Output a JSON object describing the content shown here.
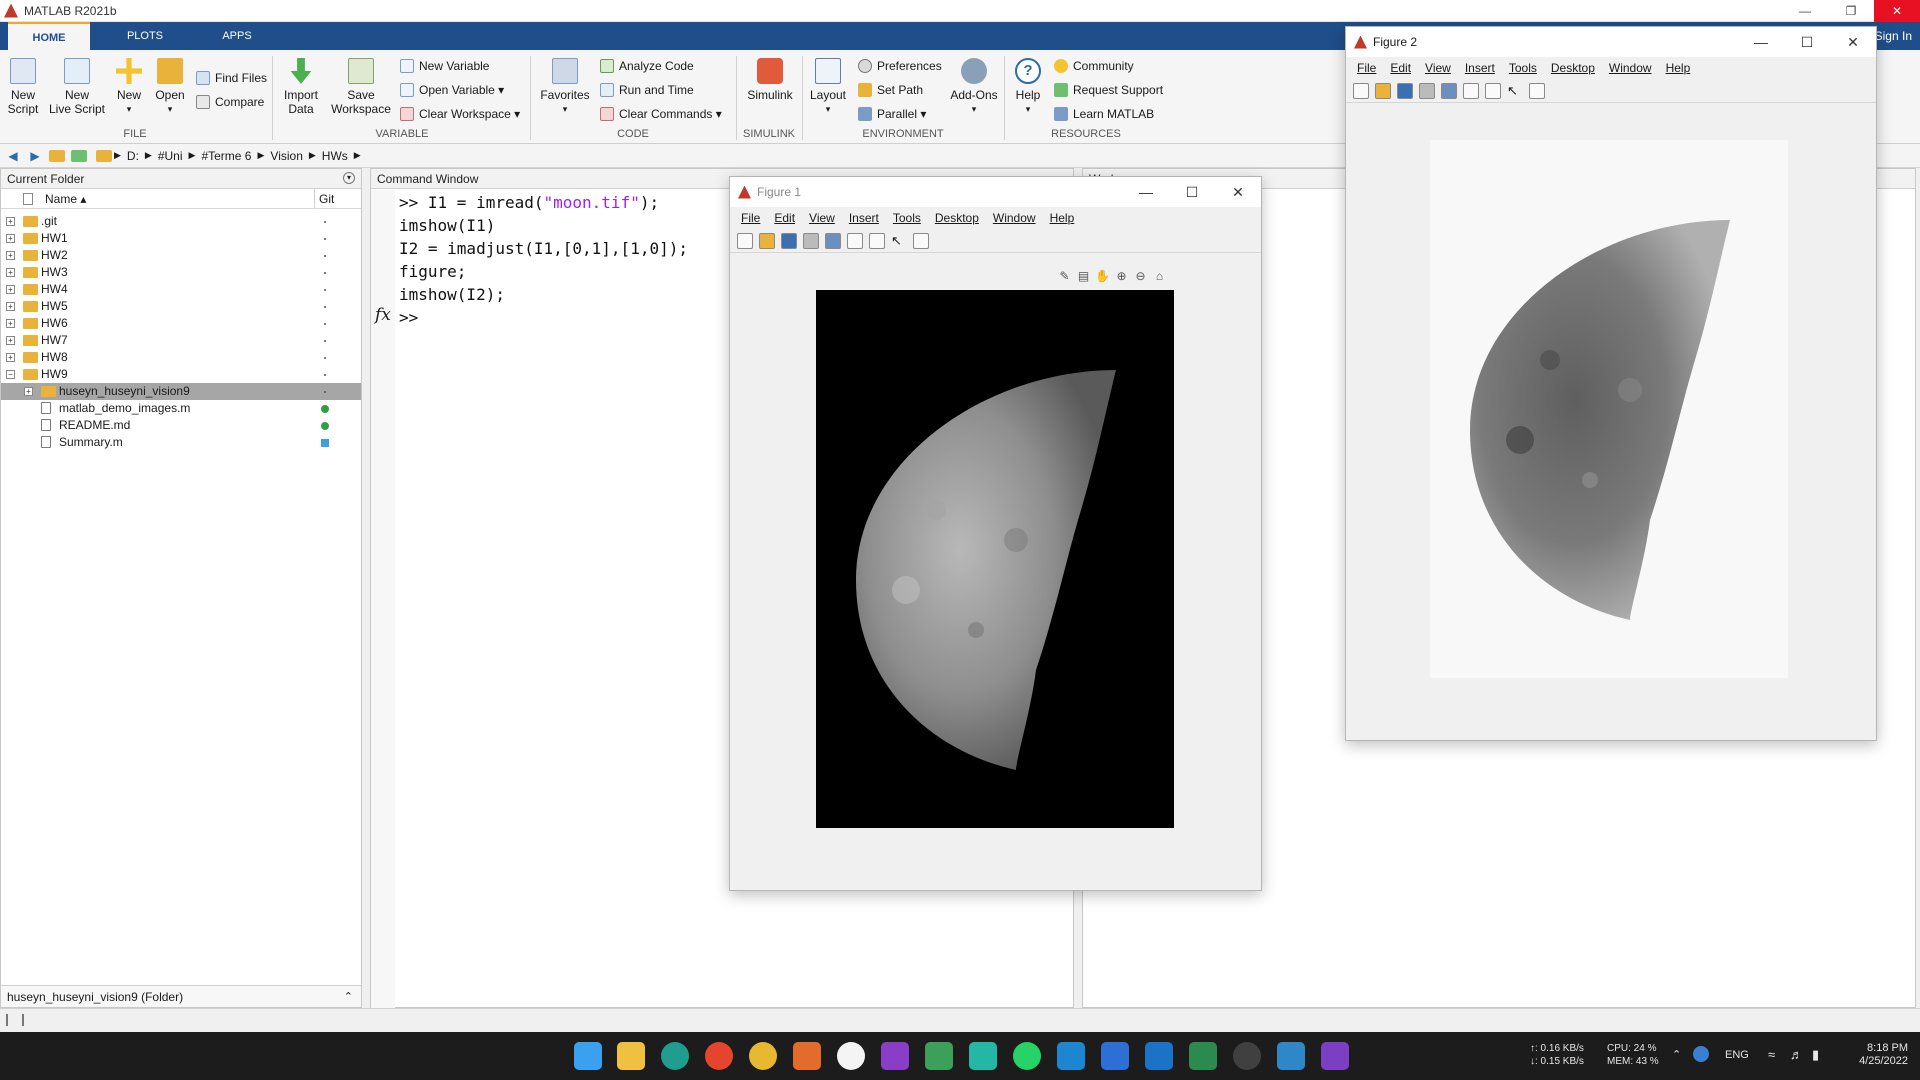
{
  "app": {
    "title": "MATLAB R2021b",
    "sign_in": "Sign In"
  },
  "tabs": [
    {
      "label": "HOME"
    },
    {
      "label": "PLOTS"
    },
    {
      "label": "APPS"
    }
  ],
  "ribbon": {
    "new_script": "New\nScript",
    "new_live_script": "New\nLive Script",
    "new": "New",
    "open": "Open",
    "find_files": "Find Files",
    "compare": "Compare",
    "import_data": "Import\nData",
    "save_workspace": "Save\nWorkspace",
    "new_variable": "New Variable",
    "open_variable": "Open Variable ▾",
    "clear_workspace": "Clear Workspace ▾",
    "favorites": "Favorites",
    "analyze_code": "Analyze Code",
    "run_and_time": "Run and Time",
    "clear_commands": "Clear Commands ▾",
    "simulink": "Simulink",
    "layout": "Layout",
    "preferences": "Preferences",
    "set_path": "Set Path",
    "parallel": "Parallel ▾",
    "add_ons": "Add-Ons",
    "help": "Help",
    "community": "Community",
    "request_support": "Request Support",
    "learn_matlab": "Learn MATLAB",
    "groups": {
      "file": "FILE",
      "variable": "VARIABLE",
      "code": "CODE",
      "simulink": "SIMULINK",
      "environment": "ENVIRONMENT",
      "resources": "RESOURCES"
    }
  },
  "address": {
    "path": [
      "D:",
      "#Uni",
      "#Terme 6",
      "Vision",
      "HWs"
    ]
  },
  "current_folder": {
    "title": "Current Folder",
    "col_name": "Name ▴",
    "col_git": "Git",
    "items": [
      {
        "name": ".git",
        "kind": "folder",
        "expand": "+",
        "git": "dot"
      },
      {
        "name": "HW1",
        "kind": "folder",
        "expand": "+",
        "git": "dot"
      },
      {
        "name": "HW2",
        "kind": "folder",
        "expand": "+",
        "git": "dot"
      },
      {
        "name": "HW3",
        "kind": "folder",
        "expand": "+",
        "git": "dot"
      },
      {
        "name": "HW4",
        "kind": "folder",
        "expand": "+",
        "git": "dot"
      },
      {
        "name": "HW5",
        "kind": "folder",
        "expand": "+",
        "git": "dot"
      },
      {
        "name": "HW6",
        "kind": "folder",
        "expand": "+",
        "git": "dot"
      },
      {
        "name": "HW7",
        "kind": "folder",
        "expand": "+",
        "git": "dot"
      },
      {
        "name": "HW8",
        "kind": "folder",
        "expand": "+",
        "git": "dot"
      },
      {
        "name": "HW9",
        "kind": "folder",
        "expand": "−",
        "git": "dot"
      },
      {
        "name": "huseyn_huseyni_vision9",
        "kind": "folder",
        "expand": "+",
        "git": "dot",
        "selected": true
      },
      {
        "name": "matlab_demo_images.m",
        "kind": "file",
        "git": "green"
      },
      {
        "name": "README.md",
        "kind": "file",
        "git": "green"
      },
      {
        "name": "Summary.m",
        "kind": "file",
        "git": "blue"
      }
    ],
    "details": "huseyn_huseyni_vision9  (Folder)"
  },
  "command_window": {
    "title": "Command Window",
    "lines": [
      {
        "prefix": ">> ",
        "code": "I1 = imread(",
        "string": "\"moon.tif\"",
        "suffix": ");"
      },
      {
        "prefix": "",
        "code": "imshow(I1)",
        "string": "",
        "suffix": ""
      },
      {
        "prefix": "",
        "code": "I2 = imadjust(I1,[0,1],[1,0]);",
        "string": "",
        "suffix": ""
      },
      {
        "prefix": "",
        "code": "figure;",
        "string": "",
        "suffix": ""
      },
      {
        "prefix": "",
        "code": "imshow(I2);",
        "string": "",
        "suffix": ""
      }
    ],
    "prompt": ">>",
    "fx": "fx"
  },
  "workspace": {
    "title": "Work"
  },
  "figure1": {
    "title": "Figure 1",
    "menu": [
      "File",
      "Edit",
      "View",
      "Insert",
      "Tools",
      "Desktop",
      "Window",
      "Help"
    ]
  },
  "figure2": {
    "title": "Figure 2",
    "menu": [
      "File",
      "Edit",
      "View",
      "Insert",
      "Tools",
      "Desktop",
      "Window",
      "Help"
    ]
  },
  "taskbar": {
    "net_up": "↑: 0.16 KB/s",
    "net_down": "↓: 0.15 KB/s",
    "cpu": "CPU: 24 %",
    "mem": "MEM: 43 %",
    "lang": "ENG",
    "time": "8:18 PM",
    "date": "4/25/2022"
  }
}
